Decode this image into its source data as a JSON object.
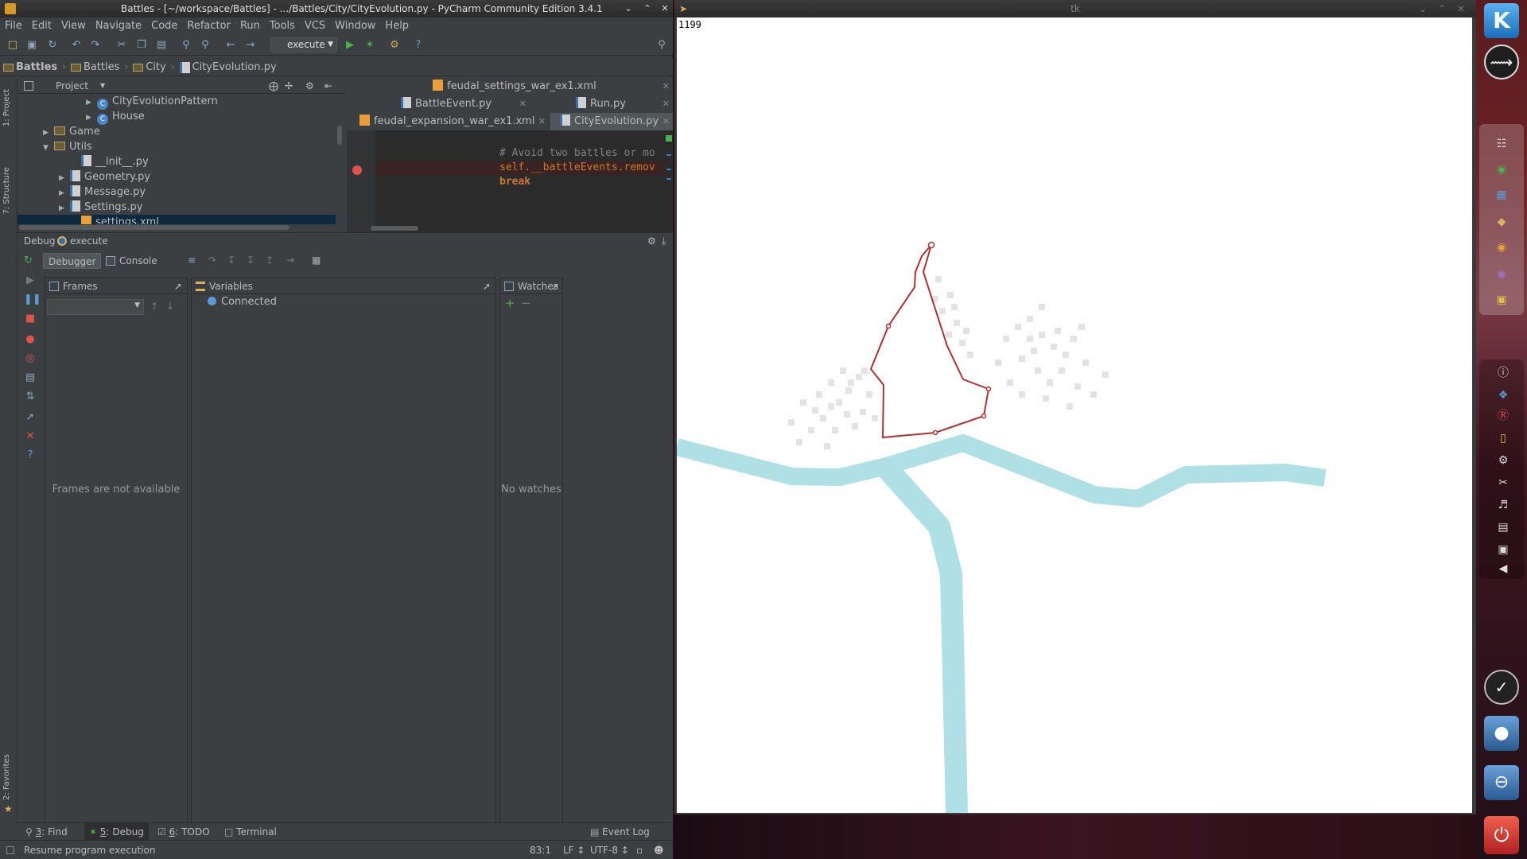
{
  "pycharm": {
    "title": "Battles - [~/workspace/Battles] - .../Battles/City/CityEvolution.py - PyCharm Community Edition 3.4.1",
    "menu": [
      "File",
      "Edit",
      "View",
      "Navigate",
      "Code",
      "Refactor",
      "Run",
      "Tools",
      "VCS",
      "Window",
      "Help"
    ],
    "run_config": "execute",
    "breadcrumbs": [
      "Battles",
      "Battles",
      "City",
      "CityEvolution.py"
    ],
    "project_panel": {
      "title": "Project",
      "tree": [
        {
          "label": "CityEvolutionPattern",
          "type": "class"
        },
        {
          "label": "House",
          "type": "class"
        },
        {
          "label": "Game",
          "type": "folder"
        },
        {
          "label": "Utils",
          "type": "folder"
        },
        {
          "label": "__init__.py",
          "type": "py"
        },
        {
          "label": "Geometry.py",
          "type": "py"
        },
        {
          "label": "Message.py",
          "type": "py"
        },
        {
          "label": "Settings.py",
          "type": "py"
        },
        {
          "label": "settings.xml",
          "type": "xml"
        }
      ]
    },
    "editor": {
      "tabs": [
        "feudal_settings_war_ex1.xml",
        "BattleEvent.py",
        "Run.py",
        "feudal_expansion_war_ex1.xml",
        "CityEvolution.py"
      ],
      "active_tab": "CityEvolution.py",
      "code": [
        "# Avoid two battles or mo",
        "self.__battleEvents.remov",
        "break"
      ]
    },
    "debug": {
      "title": "Debug",
      "config": "execute",
      "tabs": [
        "Debugger",
        "Console"
      ],
      "frames_title": "Frames",
      "frames_empty": "Frames are not available",
      "variables_title": "Variables",
      "variables_status": "Connected",
      "watches_title": "Watches",
      "watches_empty": "No watches"
    },
    "tool_windows": [
      {
        "num": "3",
        "label": ": Find"
      },
      {
        "num": "5",
        "label": ": Debug"
      },
      {
        "num": "6",
        "label": ": TODO"
      },
      {
        "num": "",
        "label": "Terminal"
      }
    ],
    "event_log": "Event Log",
    "status": {
      "message": "Resume program execution",
      "position": "83:1",
      "line_sep": "LF ↕",
      "encoding": "UTF-8 ↕"
    },
    "left_stripe": [
      "1: Project",
      "7: Structure",
      "2: Favorites"
    ]
  },
  "tk": {
    "title": "tk",
    "counter": "1199"
  },
  "colors": {
    "river": "#aee0e6",
    "wall": "#b03030",
    "house": "#e2e2e2",
    "ide_bg": "#3c3f41",
    "editor_bg": "#2b2b2b"
  }
}
